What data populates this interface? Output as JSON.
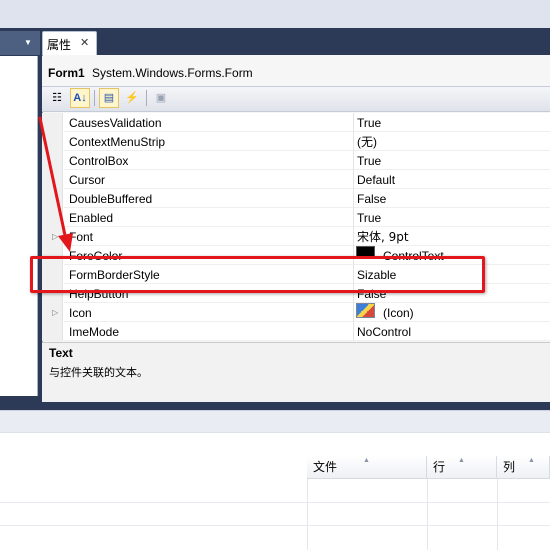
{
  "tab": {
    "title": "属性",
    "close_glyph": "✕"
  },
  "header": {
    "object_name": "Form1",
    "object_type": "System.Windows.Forms.Form"
  },
  "toolbar": {
    "buttons": [
      {
        "name": "categorized-button",
        "glyph": "☷",
        "active": false
      },
      {
        "name": "alphabetical-button",
        "glyph": "A↓",
        "active": true
      },
      {
        "name": "properties-button",
        "glyph": "▤",
        "active": true
      },
      {
        "name": "events-button",
        "glyph": "⚡",
        "active": false
      },
      {
        "name": "property-pages-button",
        "glyph": "▣",
        "active": false
      }
    ]
  },
  "properties": [
    {
      "name": "CausesValidation",
      "value": "True"
    },
    {
      "name": "ContextMenuStrip",
      "value": "(无)"
    },
    {
      "name": "ControlBox",
      "value": "True"
    },
    {
      "name": "Cursor",
      "value": "Default"
    },
    {
      "name": "DoubleBuffered",
      "value": "False"
    },
    {
      "name": "Enabled",
      "value": "True"
    },
    {
      "name": "Font",
      "value": "宋体, 9pt",
      "expandable": true
    },
    {
      "name": "ForeColor",
      "value": "ControlText",
      "swatch": "#000000"
    },
    {
      "name": "FormBorderStyle",
      "value": "Sizable",
      "highlighted": true
    },
    {
      "name": "HelpButton",
      "value": "False"
    },
    {
      "name": "Icon",
      "value": "(Icon)",
      "expandable": true,
      "swatch": "icon"
    },
    {
      "name": "ImeMode",
      "value": "NoControl"
    }
  ],
  "description": {
    "title": "Text",
    "text": "与控件关联的文本。"
  },
  "error_list": {
    "columns": [
      "文件",
      "行",
      "列"
    ]
  },
  "colors": {
    "annotation": "#e3161b",
    "background": "#2c3a58"
  }
}
